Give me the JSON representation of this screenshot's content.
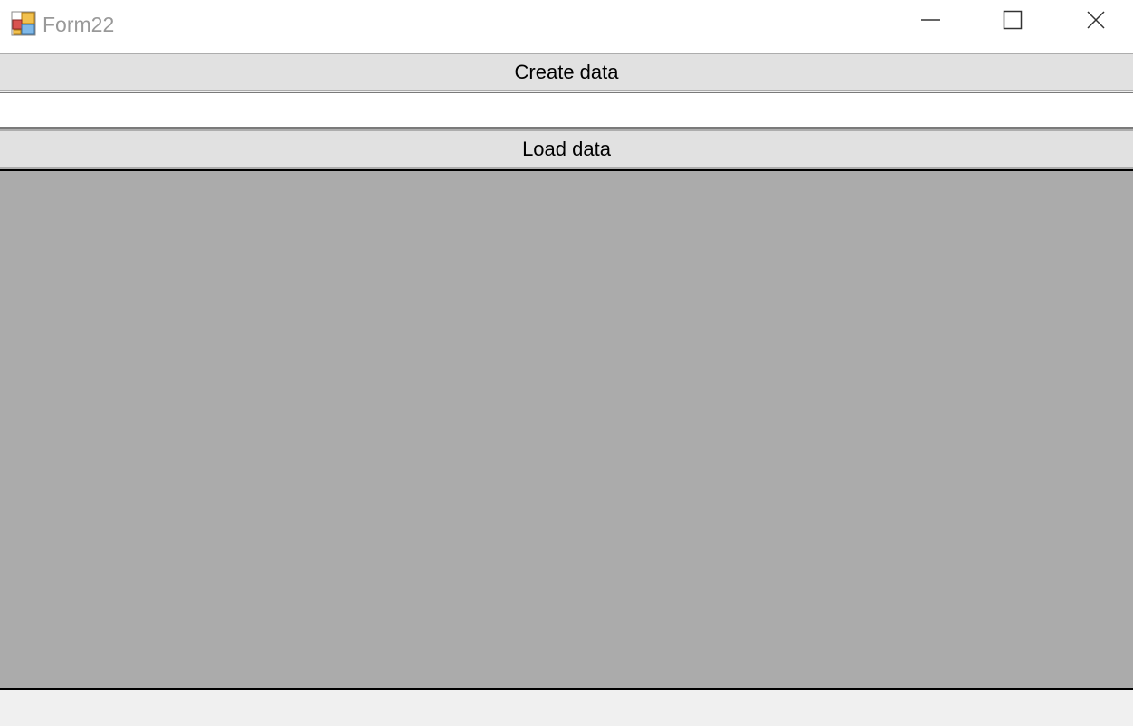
{
  "window": {
    "title": "Form22",
    "icon": "form-app-icon",
    "caption_buttons": [
      "minimize-icon",
      "maximize-icon",
      "close-icon"
    ]
  },
  "buttons": {
    "create_label": "Create data",
    "load_label": "Load data"
  },
  "input": {
    "value": "",
    "placeholder": ""
  },
  "colors": {
    "titlebar": "#ffffff",
    "button_face": "#e1e1e1",
    "grid_background": "#ababab",
    "form_background": "#f0f0f0"
  }
}
